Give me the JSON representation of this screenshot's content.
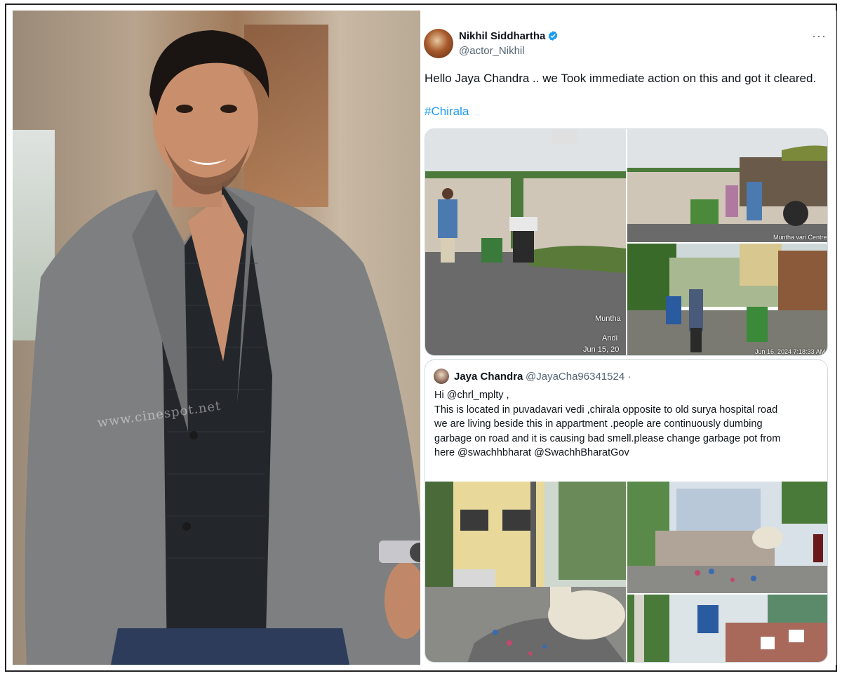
{
  "tweet": {
    "author_name": "Nikhil Siddhartha",
    "author_handle": "@actor_Nikhil",
    "more_label": "···",
    "text": "Hello Jaya Chandra .. we Took immediate action on this and got it cleared.",
    "hashtag": "#Chirala",
    "photos": [
      {
        "caption1": "Muntha",
        "caption2": "Andi",
        "caption3": "Jun 15, 20"
      },
      {
        "caption1": "Muntha vari Centre"
      },
      {
        "caption1": "Jun 16, 2024 7:18:33 AM"
      }
    ]
  },
  "quoted_tweet": {
    "author_name": "Jaya Chandra",
    "author_handle": "@JayaCha96341524 ·",
    "lines": [
      "Hi @chrl_mplty ,",
      "This is located in puvadavari vedi ,chirala opposite to old surya hospital road",
      "we are living beside this in appartment .people are continuously dumbing",
      "garbage on road and it is causing bad smell.please change garbage pot from",
      "here @swachhbharat @SwachhBharatGov"
    ]
  },
  "portrait": {
    "watermark": "www.cinespot.net"
  },
  "colors": {
    "link": "#1d9bf0",
    "secondary_text": "#536471",
    "verified": "#1d9bf0"
  }
}
